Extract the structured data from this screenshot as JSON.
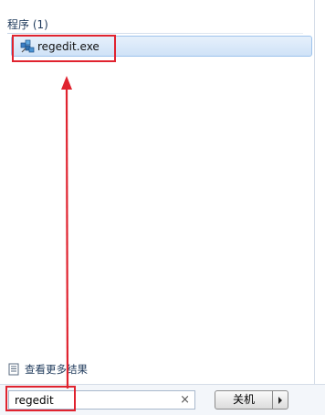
{
  "results": {
    "header": "程序 (1)",
    "items": [
      {
        "label": "regedit.exe",
        "icon": "registry-editor-icon"
      }
    ]
  },
  "more_results": {
    "label": "查看更多结果",
    "icon": "document-icon"
  },
  "search": {
    "value": "regedit",
    "clear_icon": "close-icon"
  },
  "shutdown": {
    "label": "关机",
    "menu_icon": "chevron-right-icon"
  },
  "annotations": {
    "color": "#e0232f"
  }
}
